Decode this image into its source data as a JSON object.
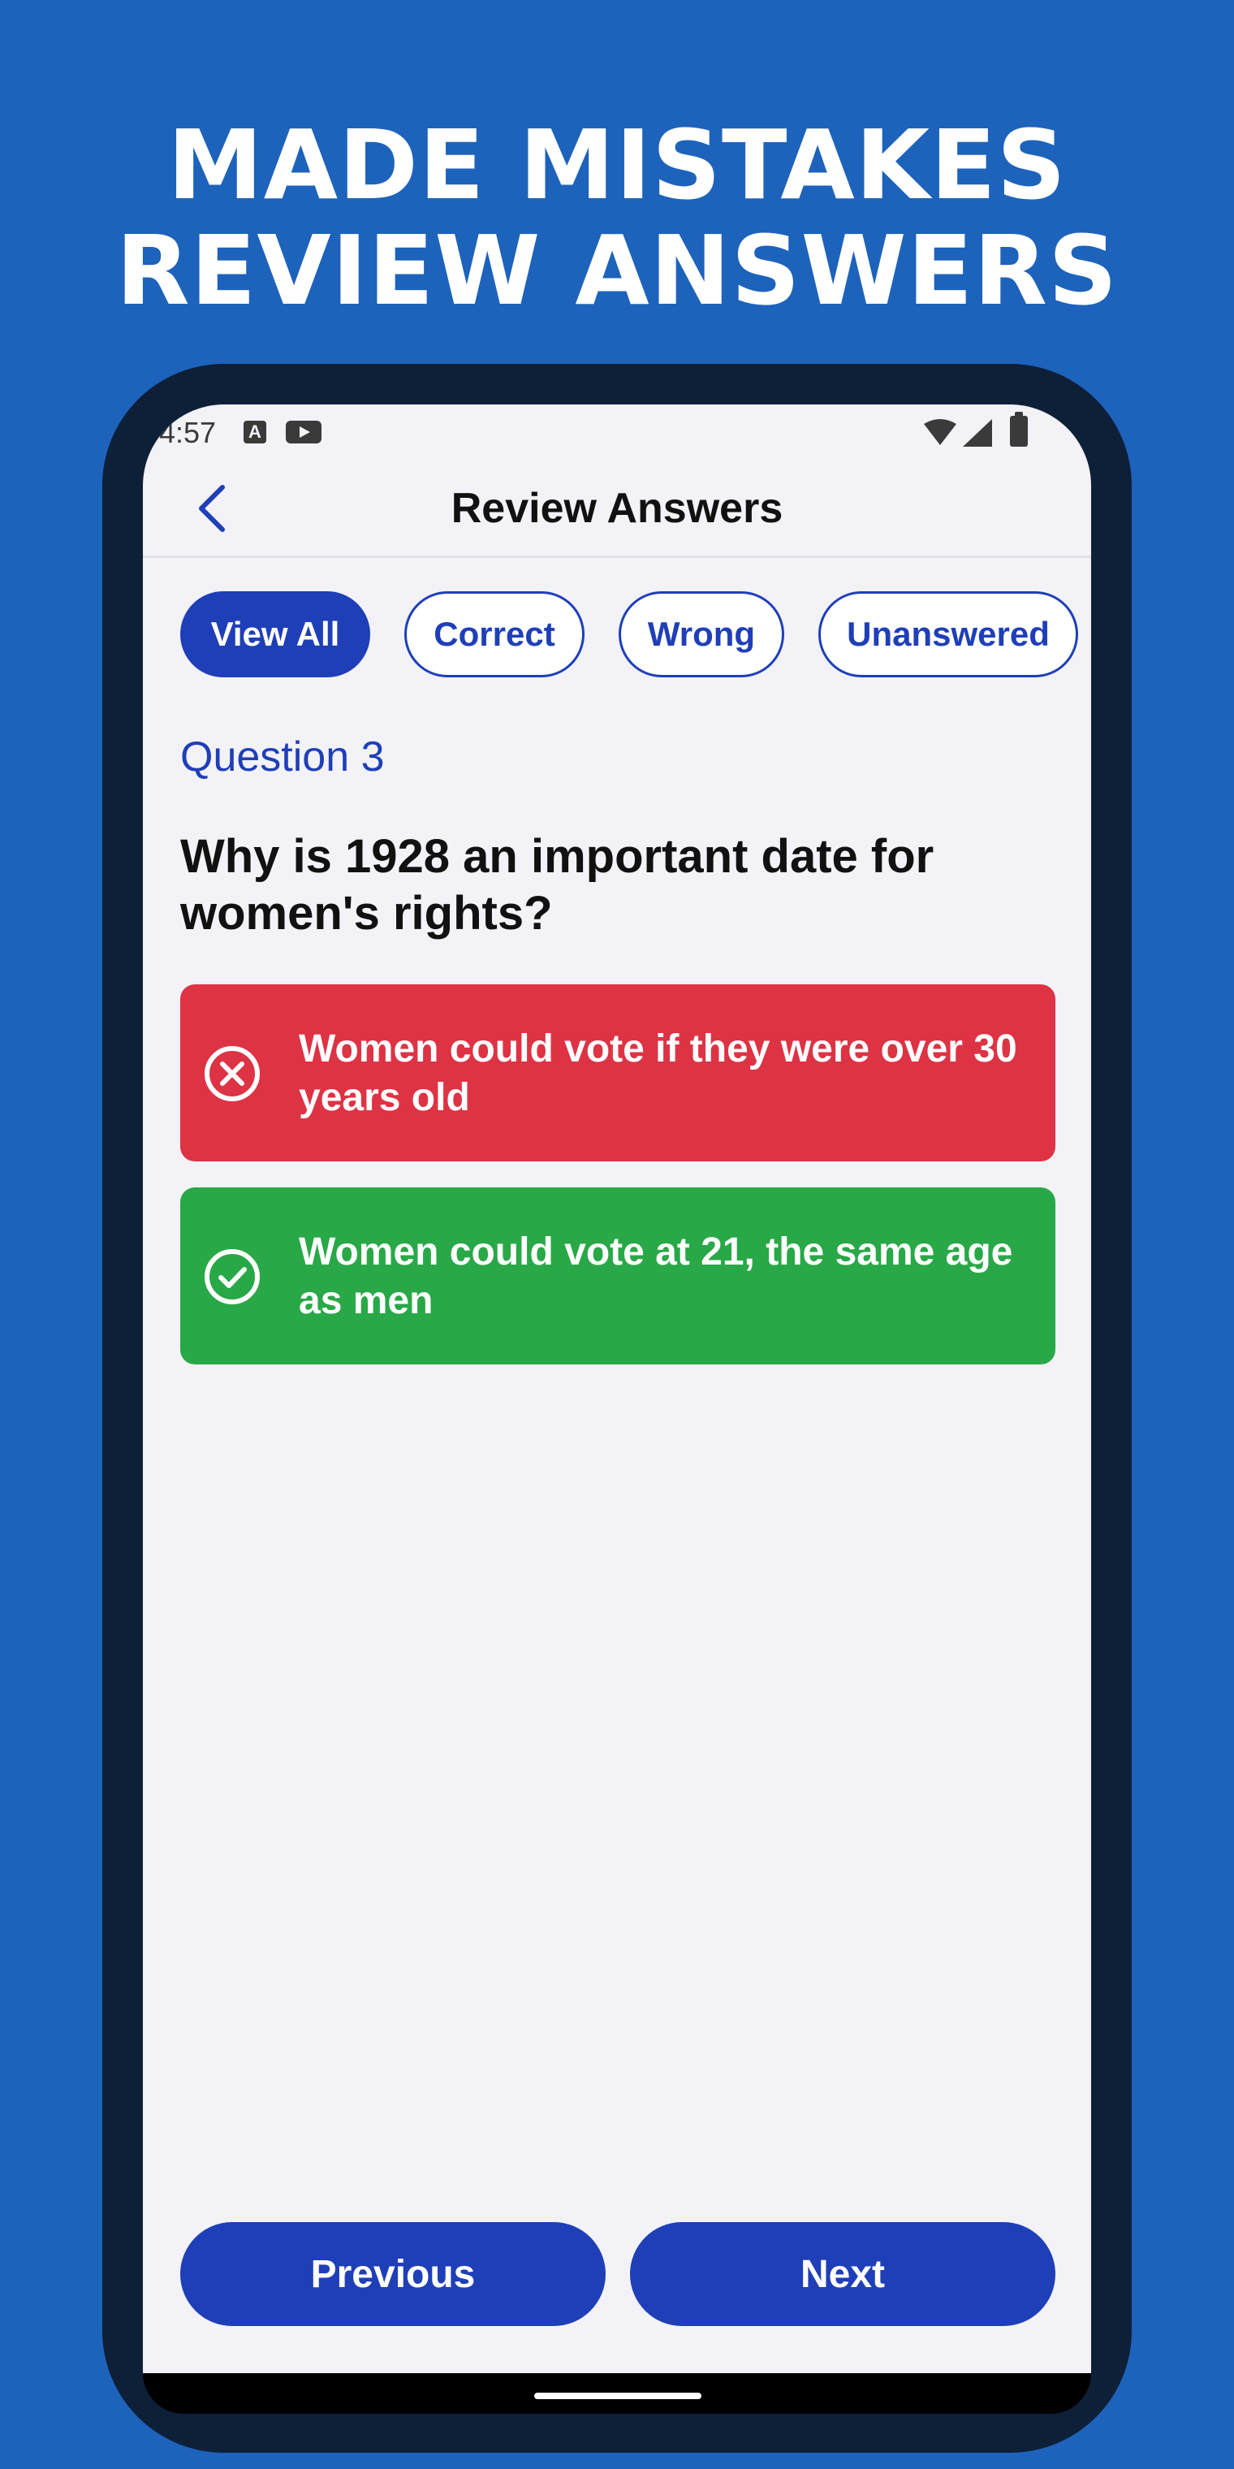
{
  "promo": {
    "headline_line1": "MADE MISTAKES",
    "headline_line2": "REVIEW ANSWERS"
  },
  "status_bar": {
    "time": "4:57",
    "notification_icons": [
      "a-icon",
      "play-icon"
    ],
    "system_icons": [
      "wifi-icon",
      "signal-icon",
      "battery-icon"
    ],
    "a_icon_glyph": "A"
  },
  "app_bar": {
    "title": "Review Answers",
    "back_icon": "chevron-left-icon"
  },
  "filters": [
    {
      "label": "View All",
      "active": true
    },
    {
      "label": "Correct",
      "active": false
    },
    {
      "label": "Wrong",
      "active": false
    },
    {
      "label": "Unanswered",
      "active": false
    }
  ],
  "question": {
    "number_label": "Question 3",
    "text": "Why is 1928 an important date for women's rights?"
  },
  "answers": [
    {
      "text": "Women could vote if they were over 30 years old",
      "status": "wrong",
      "icon": "x-circle-icon"
    },
    {
      "text": "Women could vote at 21, the same age as men",
      "status": "correct",
      "icon": "check-circle-icon"
    }
  ],
  "navigation": {
    "previous_label": "Previous",
    "next_label": "Next"
  },
  "colors": {
    "background": "#1d63bb",
    "accent": "#1f3fb8",
    "wrong": "#de3344",
    "correct": "#29a847",
    "phone_frame": "#0e1f38"
  }
}
